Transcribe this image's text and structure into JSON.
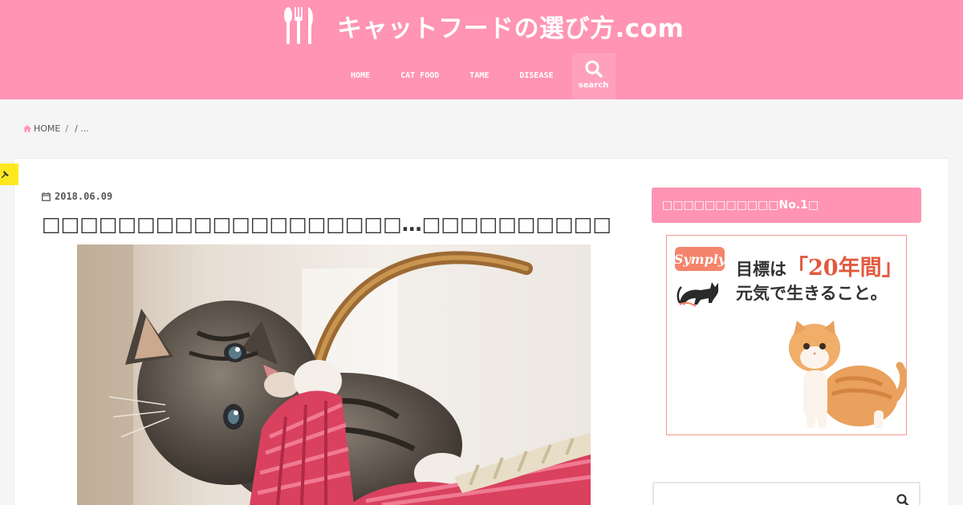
{
  "site": {
    "title": "キャットフードの選び方.com"
  },
  "nav": {
    "items": [
      {
        "label": "HOME"
      },
      {
        "label": "CAT FOOD"
      },
      {
        "label": "TAME"
      },
      {
        "label": "DISEASE"
      }
    ],
    "search_label": "search"
  },
  "breadcrumb": {
    "home": "HOME",
    "sep": "/",
    "current": "/ ..."
  },
  "article": {
    "date": "2018.06.09",
    "title": "□□□□□□□□□□□□□□□□□□□…□□□□□□□□□□"
  },
  "sidebar": {
    "widget_title": "□□□□□□□□□□□No.1□",
    "ad": {
      "brand": "Symply",
      "line1_pre": "目標は",
      "line1_hl": "「20年間」",
      "line2": "元気で生きること。"
    },
    "search_placeholder": ""
  },
  "colors": {
    "header": "#ff94b5",
    "accent_tag": "#ffe81f",
    "ad_brand": "#f4846b"
  }
}
